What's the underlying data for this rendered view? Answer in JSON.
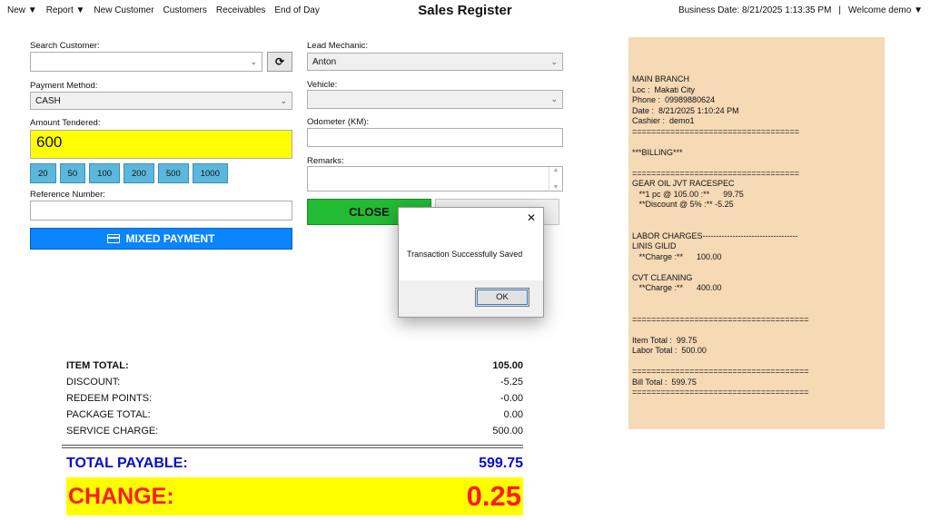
{
  "menu": {
    "items": [
      {
        "label": "New",
        "arrow": "▼"
      },
      {
        "label": "Report",
        "arrow": "▼"
      },
      {
        "label": "New Customer"
      },
      {
        "label": "Customers"
      },
      {
        "label": "Receivables"
      },
      {
        "label": "End of Day"
      }
    ]
  },
  "header": {
    "title": "Sales Register",
    "business_date": "Business Date: 8/21/2025 1:13:35 PM",
    "separator": "|",
    "welcome": "Welcome demo",
    "welcome_arrow": "▼"
  },
  "form": {
    "search_customer_label": "Search Customer:",
    "search_customer_value": "",
    "refresh_icon": "⟳",
    "payment_method_label": "Payment Method:",
    "payment_method_value": "CASH",
    "amount_tendered_label": "Amount Tendered:",
    "amount_tendered_value": "600",
    "quick_amounts": [
      "20",
      "50",
      "100",
      "200",
      "500",
      "1000"
    ],
    "reference_number_label": "Reference Number:",
    "reference_number_value": "",
    "mixed_payment_label": "MIXED PAYMENT",
    "lead_mechanic_label": "Lead Mechanic:",
    "lead_mechanic_value": "Anton",
    "vehicle_label": "Vehicle:",
    "vehicle_value": "",
    "odometer_label": "Odometer (KM):",
    "odometer_value": "",
    "remarks_label": "Remarks:",
    "remarks_value": "",
    "close_label": "CLOSE",
    "chevron": "⌄"
  },
  "totals": {
    "rows": [
      {
        "label": "ITEM TOTAL:",
        "value": "105.00"
      },
      {
        "label": "DISCOUNT:",
        "value": "-5.25"
      },
      {
        "label": "REDEEM POINTS:",
        "value": "-0.00"
      },
      {
        "label": "PACKAGE TOTAL:",
        "value": "0.00"
      },
      {
        "label": "SERVICE CHARGE:",
        "value": "500.00"
      }
    ],
    "total_payable_label": "TOTAL PAYABLE:",
    "total_payable_value": "599.75",
    "change_label": "CHANGE:",
    "change_value": "0.25"
  },
  "dialog": {
    "close_icon": "✕",
    "message": "Transaction Successfully Saved",
    "ok_label": "OK"
  },
  "receipt": {
    "lines": [
      "MAIN BRANCH",
      "Loc :  Makati City",
      "Phone :  09989880624",
      "Date :  8/21/2025 1:10:24 PM",
      "Cashier :  demo1",
      "===================================",
      "",
      "***BILLING***",
      "",
      "===================================",
      "GEAR OIL JVT RACESPEC",
      "   **1 pc @ 105.00 :**      99.75",
      "   **Discount @ 5% :** -5.25",
      "",
      "",
      "LABOR CHARGES-----------------------------------",
      "LINIS GILID",
      "   **Charge :**      100.00",
      "",
      "CVT CLEANING",
      "   **Charge :**      400.00",
      "",
      "",
      "=====================================",
      "",
      "Item Total :  99.75",
      "Labor Total :  500.00",
      "",
      "=====================================",
      "Bill Total :  599.75",
      "====================================="
    ]
  },
  "colors": {
    "amount_bg": "#ffff00",
    "quick_btn": "#5bb8dc",
    "mixed_btn": "#0a84ff",
    "close_btn": "#22bb33",
    "total_payable": "#0b0bd1",
    "change_text": "#ff1a1a",
    "receipt_bg": "#f6d9b5"
  }
}
